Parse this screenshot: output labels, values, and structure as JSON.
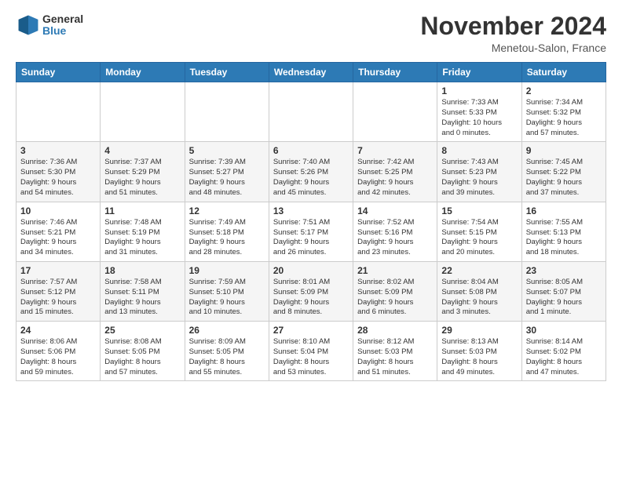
{
  "header": {
    "logo_line1": "General",
    "logo_line2": "Blue",
    "month": "November 2024",
    "location": "Menetou-Salon, France"
  },
  "weekdays": [
    "Sunday",
    "Monday",
    "Tuesday",
    "Wednesday",
    "Thursday",
    "Friday",
    "Saturday"
  ],
  "weeks": [
    [
      {
        "day": "",
        "info": ""
      },
      {
        "day": "",
        "info": ""
      },
      {
        "day": "",
        "info": ""
      },
      {
        "day": "",
        "info": ""
      },
      {
        "day": "",
        "info": ""
      },
      {
        "day": "1",
        "info": "Sunrise: 7:33 AM\nSunset: 5:33 PM\nDaylight: 10 hours\nand 0 minutes."
      },
      {
        "day": "2",
        "info": "Sunrise: 7:34 AM\nSunset: 5:32 PM\nDaylight: 9 hours\nand 57 minutes."
      }
    ],
    [
      {
        "day": "3",
        "info": "Sunrise: 7:36 AM\nSunset: 5:30 PM\nDaylight: 9 hours\nand 54 minutes."
      },
      {
        "day": "4",
        "info": "Sunrise: 7:37 AM\nSunset: 5:29 PM\nDaylight: 9 hours\nand 51 minutes."
      },
      {
        "day": "5",
        "info": "Sunrise: 7:39 AM\nSunset: 5:27 PM\nDaylight: 9 hours\nand 48 minutes."
      },
      {
        "day": "6",
        "info": "Sunrise: 7:40 AM\nSunset: 5:26 PM\nDaylight: 9 hours\nand 45 minutes."
      },
      {
        "day": "7",
        "info": "Sunrise: 7:42 AM\nSunset: 5:25 PM\nDaylight: 9 hours\nand 42 minutes."
      },
      {
        "day": "8",
        "info": "Sunrise: 7:43 AM\nSunset: 5:23 PM\nDaylight: 9 hours\nand 39 minutes."
      },
      {
        "day": "9",
        "info": "Sunrise: 7:45 AM\nSunset: 5:22 PM\nDaylight: 9 hours\nand 37 minutes."
      }
    ],
    [
      {
        "day": "10",
        "info": "Sunrise: 7:46 AM\nSunset: 5:21 PM\nDaylight: 9 hours\nand 34 minutes."
      },
      {
        "day": "11",
        "info": "Sunrise: 7:48 AM\nSunset: 5:19 PM\nDaylight: 9 hours\nand 31 minutes."
      },
      {
        "day": "12",
        "info": "Sunrise: 7:49 AM\nSunset: 5:18 PM\nDaylight: 9 hours\nand 28 minutes."
      },
      {
        "day": "13",
        "info": "Sunrise: 7:51 AM\nSunset: 5:17 PM\nDaylight: 9 hours\nand 26 minutes."
      },
      {
        "day": "14",
        "info": "Sunrise: 7:52 AM\nSunset: 5:16 PM\nDaylight: 9 hours\nand 23 minutes."
      },
      {
        "day": "15",
        "info": "Sunrise: 7:54 AM\nSunset: 5:15 PM\nDaylight: 9 hours\nand 20 minutes."
      },
      {
        "day": "16",
        "info": "Sunrise: 7:55 AM\nSunset: 5:13 PM\nDaylight: 9 hours\nand 18 minutes."
      }
    ],
    [
      {
        "day": "17",
        "info": "Sunrise: 7:57 AM\nSunset: 5:12 PM\nDaylight: 9 hours\nand 15 minutes."
      },
      {
        "day": "18",
        "info": "Sunrise: 7:58 AM\nSunset: 5:11 PM\nDaylight: 9 hours\nand 13 minutes."
      },
      {
        "day": "19",
        "info": "Sunrise: 7:59 AM\nSunset: 5:10 PM\nDaylight: 9 hours\nand 10 minutes."
      },
      {
        "day": "20",
        "info": "Sunrise: 8:01 AM\nSunset: 5:09 PM\nDaylight: 9 hours\nand 8 minutes."
      },
      {
        "day": "21",
        "info": "Sunrise: 8:02 AM\nSunset: 5:09 PM\nDaylight: 9 hours\nand 6 minutes."
      },
      {
        "day": "22",
        "info": "Sunrise: 8:04 AM\nSunset: 5:08 PM\nDaylight: 9 hours\nand 3 minutes."
      },
      {
        "day": "23",
        "info": "Sunrise: 8:05 AM\nSunset: 5:07 PM\nDaylight: 9 hours\nand 1 minute."
      }
    ],
    [
      {
        "day": "24",
        "info": "Sunrise: 8:06 AM\nSunset: 5:06 PM\nDaylight: 8 hours\nand 59 minutes."
      },
      {
        "day": "25",
        "info": "Sunrise: 8:08 AM\nSunset: 5:05 PM\nDaylight: 8 hours\nand 57 minutes."
      },
      {
        "day": "26",
        "info": "Sunrise: 8:09 AM\nSunset: 5:05 PM\nDaylight: 8 hours\nand 55 minutes."
      },
      {
        "day": "27",
        "info": "Sunrise: 8:10 AM\nSunset: 5:04 PM\nDaylight: 8 hours\nand 53 minutes."
      },
      {
        "day": "28",
        "info": "Sunrise: 8:12 AM\nSunset: 5:03 PM\nDaylight: 8 hours\nand 51 minutes."
      },
      {
        "day": "29",
        "info": "Sunrise: 8:13 AM\nSunset: 5:03 PM\nDaylight: 8 hours\nand 49 minutes."
      },
      {
        "day": "30",
        "info": "Sunrise: 8:14 AM\nSunset: 5:02 PM\nDaylight: 8 hours\nand 47 minutes."
      }
    ]
  ]
}
